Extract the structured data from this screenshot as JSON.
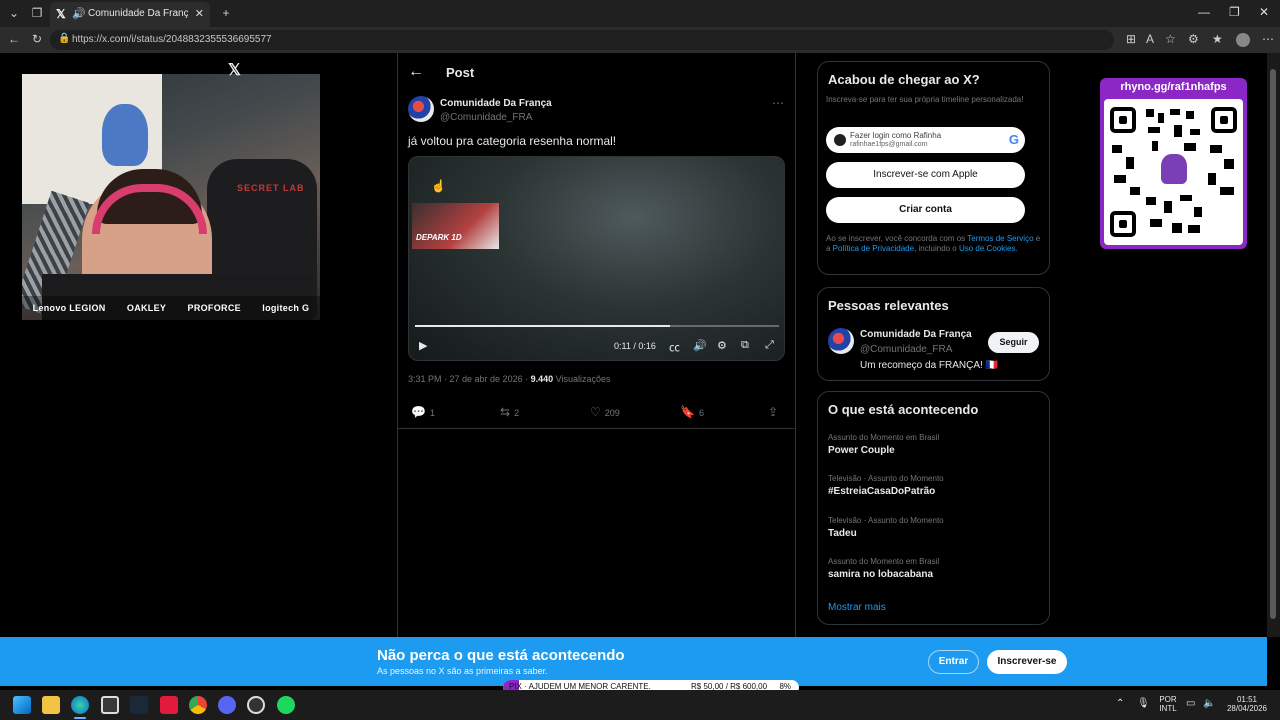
{
  "browser": {
    "tab_title": "Comunidade Da França no X:",
    "url": "https://x.com/i/status/2048832355536695577",
    "tab_icon": "x-logo"
  },
  "stream_overlay": {
    "chair_brand": "SECRET LAB",
    "sponsors": [
      "Lenovo LEGION",
      "OAKLEY",
      "PROFORCE",
      "logitech G"
    ],
    "x_logo": "𝕏"
  },
  "post": {
    "header_title": "Post",
    "author_name": "Comunidade Da França",
    "author_handle": "@Comunidade_FRA",
    "text": "já voltou pra categoria resenha normal!",
    "video": {
      "inset_label": "DEPARK 1D",
      "time": "0:11 / 0:16",
      "progress": 0.7
    },
    "timestamp": "3:31 PM · 27 de abr de 2026 · ",
    "views_count": "9.440",
    "views_label": "Visualizações",
    "replies": "1",
    "reposts": "2",
    "likes": "209",
    "bookmarks": "6"
  },
  "signup": {
    "title": "Acabou de chegar ao X?",
    "subtitle": "Inscreva-se para ter sua própria timeline personalizada!",
    "google_line1": "Fazer login como Rafinha",
    "google_line2": "rafinhae1fps@gmail.com",
    "apple_label": "Inscrever-se com Apple",
    "create_label": "Criar conta",
    "terms_prefix": "Ao se inscrever, você concorda com os ",
    "terms_link": "Termos de Serviço",
    "terms_mid": " e a ",
    "privacy_link": "Política de Privacidade",
    "terms_mid2": ", incluindo o ",
    "cookies_link": "Uso de Cookies",
    "terms_end": "."
  },
  "people": {
    "title": "Pessoas relevantes",
    "name": "Comunidade Da França",
    "handle": "@Comunidade_FRA",
    "bio": "Um recomeço da FRANÇA! 🇫🇷",
    "follow_label": "Seguir"
  },
  "trends": {
    "title": "O que está acontecendo",
    "items": [
      {
        "category": "Assunto do Momento em Brasil",
        "name": "Power Couple"
      },
      {
        "category": "Televisão · Assunto do Momento",
        "name": "#EstreiaCasaDoPatrão"
      },
      {
        "category": "Televisão · Assunto do Momento",
        "name": "Tadeu"
      },
      {
        "category": "Assunto do Momento em Brasil",
        "name": "samira no lobacabana"
      }
    ],
    "show_more": "Mostrar mais"
  },
  "qr": {
    "url": "rhyno.gg/raf1nhafps"
  },
  "banner": {
    "title": "Não perca o que está acontecendo",
    "subtitle": "As pessoas no X são as primeiras a saber.",
    "login_label": "Entrar",
    "register_label": "Inscrever-se"
  },
  "ticker": {
    "label": "PIX · AJUDEM UM MENOR CARENTE.",
    "amount": "R$ 50,00 / R$ 600,00",
    "percent": "8%"
  },
  "taskbar": {
    "lang_line1": "POR",
    "lang_line2": "INTL",
    "time": "01:51",
    "date": "28/04/2026"
  },
  "colors": {
    "accent": "#1d9bf0",
    "background": "#000000",
    "border": "#2f3336",
    "qr_frame": "#8b27c4"
  }
}
